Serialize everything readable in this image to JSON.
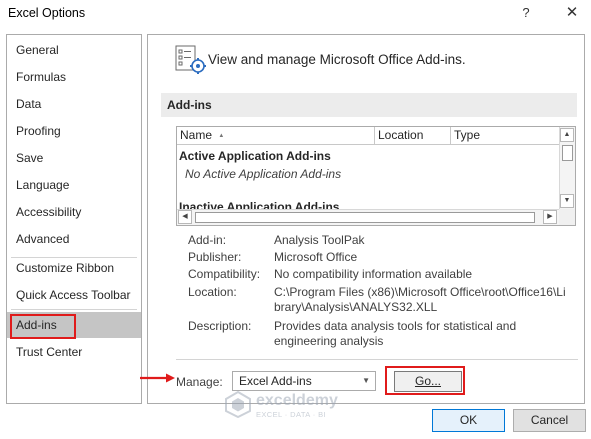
{
  "window": {
    "title": "Excel Options",
    "help_glyph": "?",
    "close_glyph": "✕"
  },
  "sidebar": {
    "items": [
      {
        "label": "General"
      },
      {
        "label": "Formulas"
      },
      {
        "label": "Data"
      },
      {
        "label": "Proofing"
      },
      {
        "label": "Save"
      },
      {
        "label": "Language"
      },
      {
        "label": "Accessibility"
      },
      {
        "label": "Advanced"
      },
      {
        "label": "Customize Ribbon"
      },
      {
        "label": "Quick Access Toolbar"
      },
      {
        "label": "Add-ins"
      },
      {
        "label": "Trust Center"
      }
    ],
    "selected": "Add-ins"
  },
  "main": {
    "heading": "View and manage Microsoft Office Add-ins.",
    "section_title": "Add-ins",
    "list": {
      "columns": [
        "Name",
        "Location",
        "Type"
      ],
      "sort_indicator": "▲",
      "groups": [
        {
          "title": "Active Application Add-ins",
          "empty_text": "No Active Application Add-ins"
        },
        {
          "title": "Inactive Application Add-ins"
        }
      ]
    },
    "details": [
      {
        "label": "Add-in:",
        "value": "Analysis ToolPak"
      },
      {
        "label": "Publisher:",
        "value": "Microsoft Office"
      },
      {
        "label": "Compatibility:",
        "value": "No compatibility information available"
      },
      {
        "label": "Location:",
        "value": "C:\\Program Files (x86)\\Microsoft Office\\root\\Office16\\Library\\Analysis\\ANALYS32.XLL"
      },
      {
        "label": "Description:",
        "value": "Provides data analysis tools for statistical and engineering analysis"
      }
    ],
    "manage": {
      "label": "Manage:",
      "selected": "Excel Add-ins",
      "go_label": "Go..."
    }
  },
  "footer": {
    "ok_label": "OK",
    "cancel_label": "Cancel"
  },
  "watermark": {
    "name": "exceldemy",
    "tagline": "EXCEL · DATA · BI"
  },
  "annotations": {
    "highlight_color": "#e01b1b"
  },
  "colors": {
    "selected_nav": "#c5c5c5",
    "section_bar": "#ececec",
    "ok_border": "#0078d7"
  }
}
